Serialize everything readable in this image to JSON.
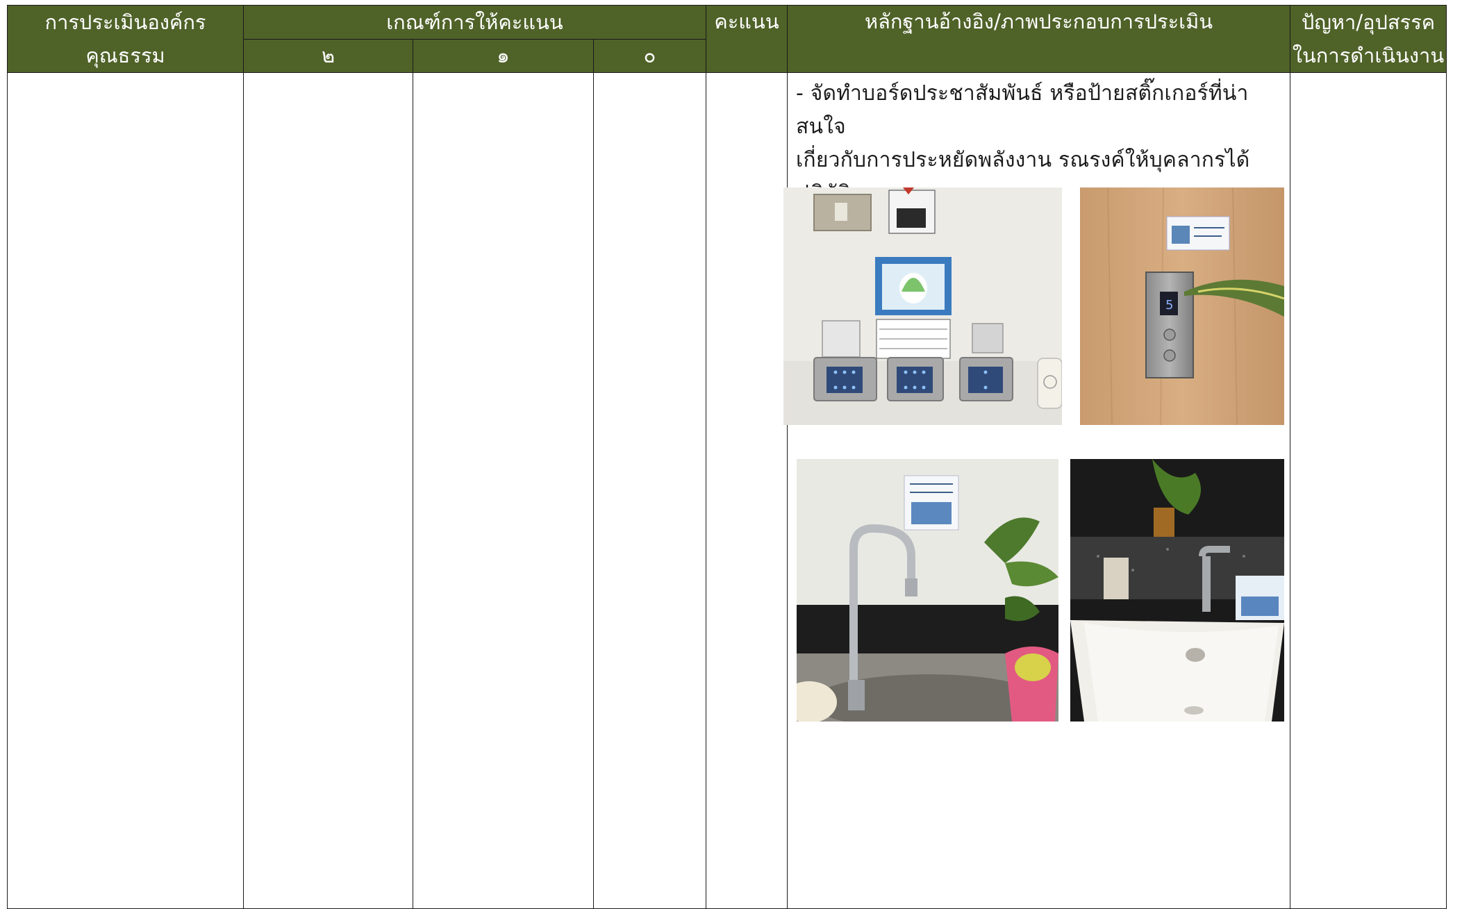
{
  "table": {
    "headers": {
      "col1_line1": "การประเมินองค์กร",
      "col1_line2": "คุณธรรม",
      "criteria": "เกณฑ์การให้คะแนน",
      "criteria_2": "๒",
      "criteria_1": "๑",
      "criteria_0": "๐",
      "score": "คะแนน",
      "evidence": "หลักฐานอ้างอิง/ภาพประกอบการประเมิน",
      "problems_line1": "ปัญหา/อุปสรรค",
      "problems_line2": "ในการดำเนินงาน"
    },
    "evidence": {
      "text_line1": "- จัดทำบอร์ดประชาสัมพันธ์ หรือป้ายสติ๊กเกอร์ที่น่าสนใจ",
      "text_line2": "เกี่ยวกับการประหยัดพลังงาน รณรงค์ให้บุคลากรได้ปฏิบัติตาม"
    }
  },
  "photos": [
    {
      "name": "light-switch-panel-photo"
    },
    {
      "name": "elevator-button-photo"
    },
    {
      "name": "kitchen-faucet-photo"
    },
    {
      "name": "washbasin-faucet-photo"
    }
  ],
  "colors": {
    "header_bg": "#4f6228",
    "header_text": "#ffffff",
    "grid": "#1a1a1a"
  }
}
